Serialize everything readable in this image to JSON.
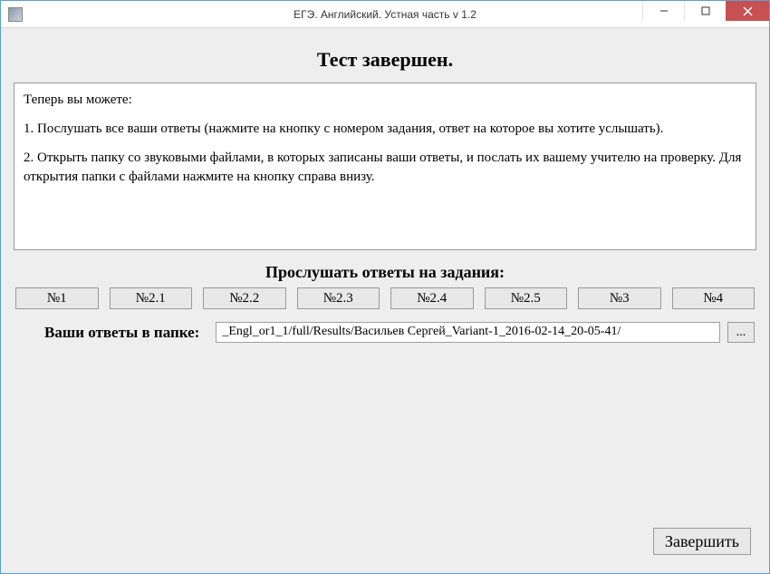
{
  "window": {
    "title": "ЕГЭ. Английский. Устная часть v 1.2"
  },
  "main": {
    "heading": "Тест завершен.",
    "info_lines": {
      "p1": "Теперь вы можете:",
      "p2": "1. Послушать все ваши ответы (нажмите на кнопку с номером задания, ответ на которое вы хотите услышать).",
      "p3": "2. Открыть папку со звуковыми файлами, в которых записаны ваши ответы, и послать их вашему учителю на проверку. Для открытия папки с файлами нажмите на кнопку справа внизу."
    },
    "listen_heading": "Прослушать ответы на задания:",
    "answer_buttons": [
      "№1",
      "№2.1",
      "№2.2",
      "№2.3",
      "№2.4",
      "№2.5",
      "№3",
      "№4"
    ],
    "folder_label": "Ваши ответы в папке:",
    "folder_path": "_Engl_or1_1/full/Results/Васильев Сергей_Variant-1_2016-02-14_20-05-41/",
    "browse_label": "...",
    "finish_label": "Завершить"
  }
}
